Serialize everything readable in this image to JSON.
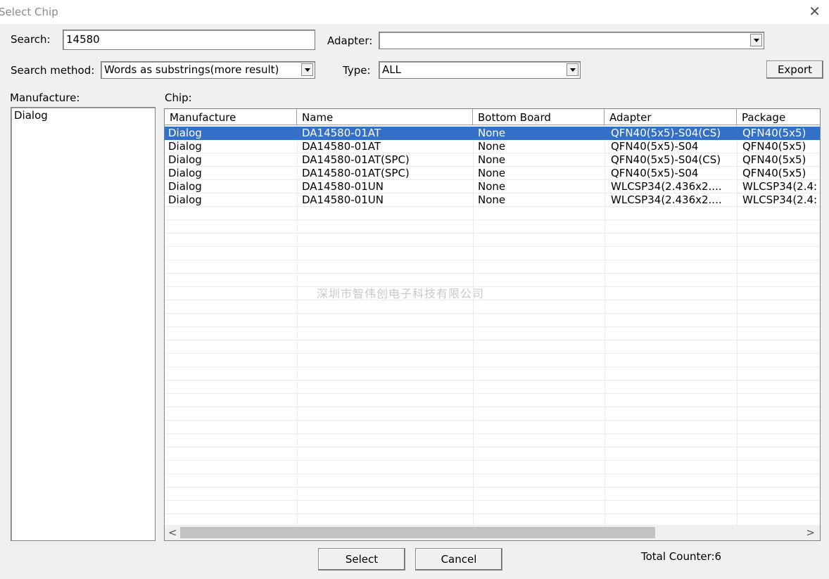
{
  "window": {
    "title": "Select Chip",
    "close_symbol": "✕"
  },
  "search": {
    "label": "Search:",
    "value": "14580"
  },
  "adapter": {
    "label": "Adapter:",
    "value": ""
  },
  "search_method": {
    "label": "Search method:",
    "value": "Words as substrings(more result)"
  },
  "type": {
    "label": "Type:",
    "value": "ALL"
  },
  "export_label": "Export",
  "manufacture_panel": {
    "label": "Manufacture:",
    "items": [
      "Dialog"
    ]
  },
  "chip_panel": {
    "label": "Chip:"
  },
  "table": {
    "columns": [
      "Manufacture",
      "Name",
      "Bottom Board",
      "Adapter",
      "Package"
    ],
    "rows": [
      [
        "Dialog",
        "DA14580-01AT",
        "None",
        "QFN40(5x5)-S04(CS)",
        "QFN40(5x5)"
      ],
      [
        "Dialog",
        "DA14580-01AT",
        "None",
        "QFN40(5x5)-S04",
        "QFN40(5x5)"
      ],
      [
        "Dialog",
        "DA14580-01AT(SPC)",
        "None",
        "QFN40(5x5)-S04(CS)",
        "QFN40(5x5)"
      ],
      [
        "Dialog",
        "DA14580-01AT(SPC)",
        "None",
        "QFN40(5x5)-S04",
        "QFN40(5x5)"
      ],
      [
        "Dialog",
        "DA14580-01UN",
        "None",
        "WLCSP34(2.436x2....",
        "WLCSP34(2.4:"
      ],
      [
        "Dialog",
        "DA14580-01UN",
        "None",
        "WLCSP34(2.436x2....",
        "WLCSP34(2.4:"
      ]
    ],
    "selected_row": 0
  },
  "watermark": "深圳市智伟创电子科技有限公司",
  "buttons": {
    "select": "Select",
    "cancel": "Cancel"
  },
  "total_counter": "Total Counter:6",
  "colors": {
    "selection": "#3470c8",
    "background": "#f0f0f0"
  }
}
